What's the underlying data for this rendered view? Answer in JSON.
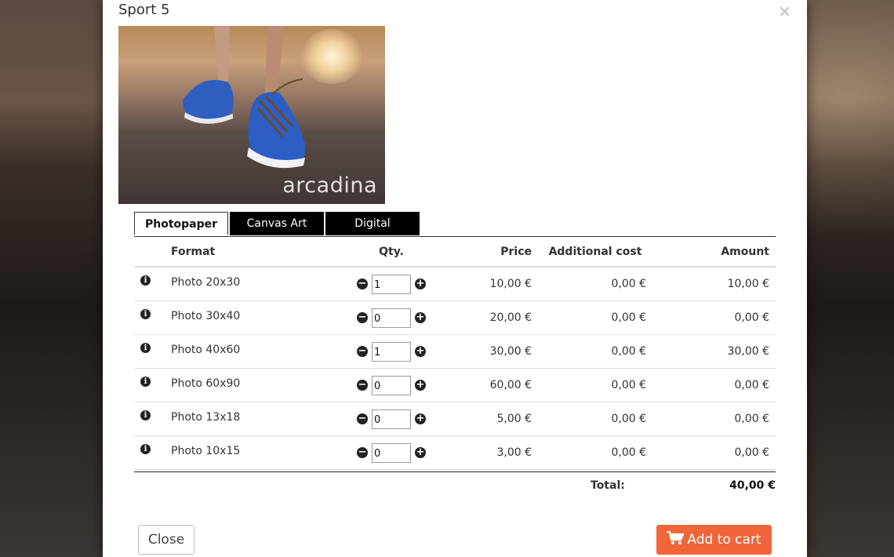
{
  "modal": {
    "title": "Sport 5",
    "close_glyph": "×"
  },
  "photo": {
    "watermark": "arcadina",
    "alt": "Sport 5"
  },
  "tabs": [
    {
      "label": "Photopaper",
      "active": true
    },
    {
      "label": "Canvas Art",
      "active": false
    },
    {
      "label": "Digital",
      "active": false
    }
  ],
  "table": {
    "headers": {
      "format": "Format",
      "qty": "Qty.",
      "price": "Price",
      "additional": "Additional cost",
      "amount": "Amount"
    },
    "rows": [
      {
        "format": "Photo 20x30",
        "qty": "1",
        "price": "10,00 €",
        "additional": "0,00 €",
        "amount": "10,00 €"
      },
      {
        "format": "Photo 30x40",
        "qty": "0",
        "price": "20,00 €",
        "additional": "0,00 €",
        "amount": "0,00 €"
      },
      {
        "format": "Photo 40x60",
        "qty": "1",
        "price": "30,00 €",
        "additional": "0,00 €",
        "amount": "30,00 €"
      },
      {
        "format": "Photo 60x90",
        "qty": "0",
        "price": "60,00 €",
        "additional": "0,00 €",
        "amount": "0,00 €"
      },
      {
        "format": "Photo 13x18",
        "qty": "0",
        "price": "5,00 €",
        "additional": "0,00 €",
        "amount": "0,00 €"
      },
      {
        "format": "Photo 10x15",
        "qty": "0",
        "price": "3,00 €",
        "additional": "0,00 €",
        "amount": "0,00 €"
      }
    ]
  },
  "total": {
    "label": "Total:",
    "value": "40,00 €"
  },
  "buttons": {
    "close_label": "Close",
    "add_to_cart_label": "Add to cart"
  },
  "icons": {
    "info": "info-icon",
    "minus": "minus-circle-icon",
    "plus": "plus-circle-icon",
    "cart": "cart-icon"
  },
  "colors": {
    "accent": "#f0663a",
    "tab_dark": "#000000"
  }
}
